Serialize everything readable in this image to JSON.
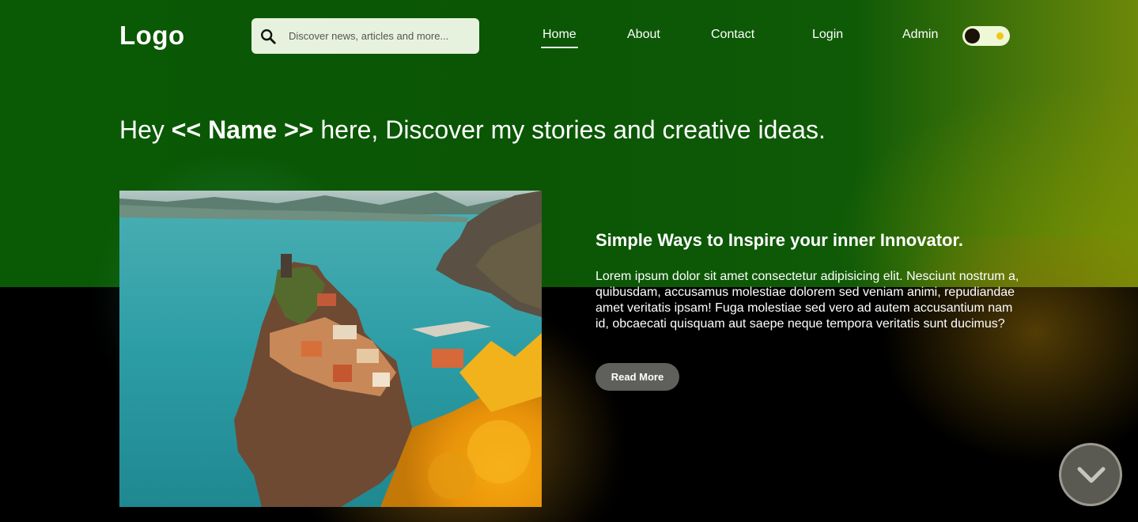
{
  "header": {
    "logo": "Logo",
    "search": {
      "placeholder": "Discover news, articles and more..."
    },
    "nav": {
      "home": "Home",
      "about": "About",
      "contact": "Contact",
      "login": "Login",
      "admin": "Admin"
    },
    "active_nav": "Home",
    "theme_toggle": {
      "state": "dark"
    }
  },
  "hero": {
    "heading_prefix": "Hey ",
    "heading_name": "<< Name >>",
    "heading_suffix": " here, Discover my stories and creative ideas."
  },
  "featured": {
    "title": "Simple Ways to Inspire your inner Innovator.",
    "body": "Lorem ipsum dolor sit amet consectetur adipisicing elit. Nesciunt nostrum a, quibusdam, accusamus molestiae dolorem sed veniam animi, repudiandae amet veritatis ipsam! Fuga molestiae sed vero ad autem accusantium nam id, obcaecati quisquam aut saepe neque tempora veritatis sunt ducimus?",
    "read_more": "Read More"
  },
  "icons": {
    "search": "search-icon",
    "scroll": "chevron-down-icon"
  },
  "colors": {
    "header_green": "#0a5605",
    "accent_yellow": "#f2c613",
    "search_bg": "#e7f2de"
  }
}
